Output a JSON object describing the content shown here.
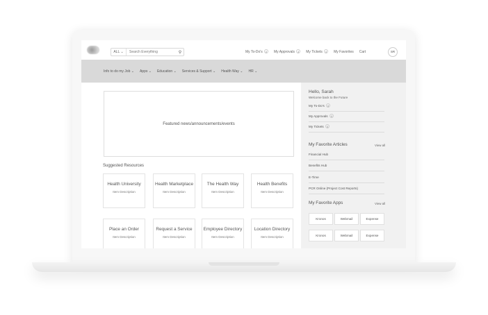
{
  "header": {
    "search_scope": "ALL",
    "search_placeholder": "Search Everything",
    "links": {
      "todos": "My To-Do's",
      "todos_count": "4",
      "approvals": "My Approvals",
      "approvals_count": "4",
      "tickets": "My Tickets",
      "tickets_count": "4",
      "favorites": "My Favorites",
      "cart": "Cart"
    },
    "avatar_initials": "SR"
  },
  "nav": {
    "items": [
      "Info to do my Job",
      "Apps",
      "Education",
      "Services & Support",
      "Health Way",
      "HR"
    ]
  },
  "main": {
    "featured_text": "Featured news/announcements/events",
    "suggested_title": "Suggested Resources",
    "resources": [
      {
        "title": "Health University",
        "desc": "Item Description"
      },
      {
        "title": "Health Marketplace",
        "desc": "Item Description"
      },
      {
        "title": "The Health Way",
        "desc": "Item Description"
      },
      {
        "title": "Health Benefits",
        "desc": "Item Description"
      },
      {
        "title": "Place an Order",
        "desc": "Item Description"
      },
      {
        "title": "Request a Service",
        "desc": "Item Description"
      },
      {
        "title": "Employee Directory",
        "desc": "Item Description"
      },
      {
        "title": "Location Directory",
        "desc": "Item Description"
      }
    ]
  },
  "panel": {
    "greeting": "Hello, Sarah",
    "welcome": "Welcome back to the Future",
    "quick": [
      {
        "label": "My To-Do's",
        "count": "4"
      },
      {
        "label": "My Approvals",
        "count": "4"
      },
      {
        "label": "My Tickets",
        "count": "4"
      }
    ],
    "articles_title": "My Favorite Articles",
    "articles_viewall": "View all",
    "articles": [
      "Financial Hub",
      "Benefits Hub",
      "E-Time",
      "PCR Online (Project Cost Reports)"
    ],
    "apps_title": "My Favorite Apps",
    "apps_viewall": "View all",
    "apps": [
      "Kronos",
      "Webmail",
      "Expense",
      "Kronos",
      "Webmail",
      "Expense"
    ]
  }
}
